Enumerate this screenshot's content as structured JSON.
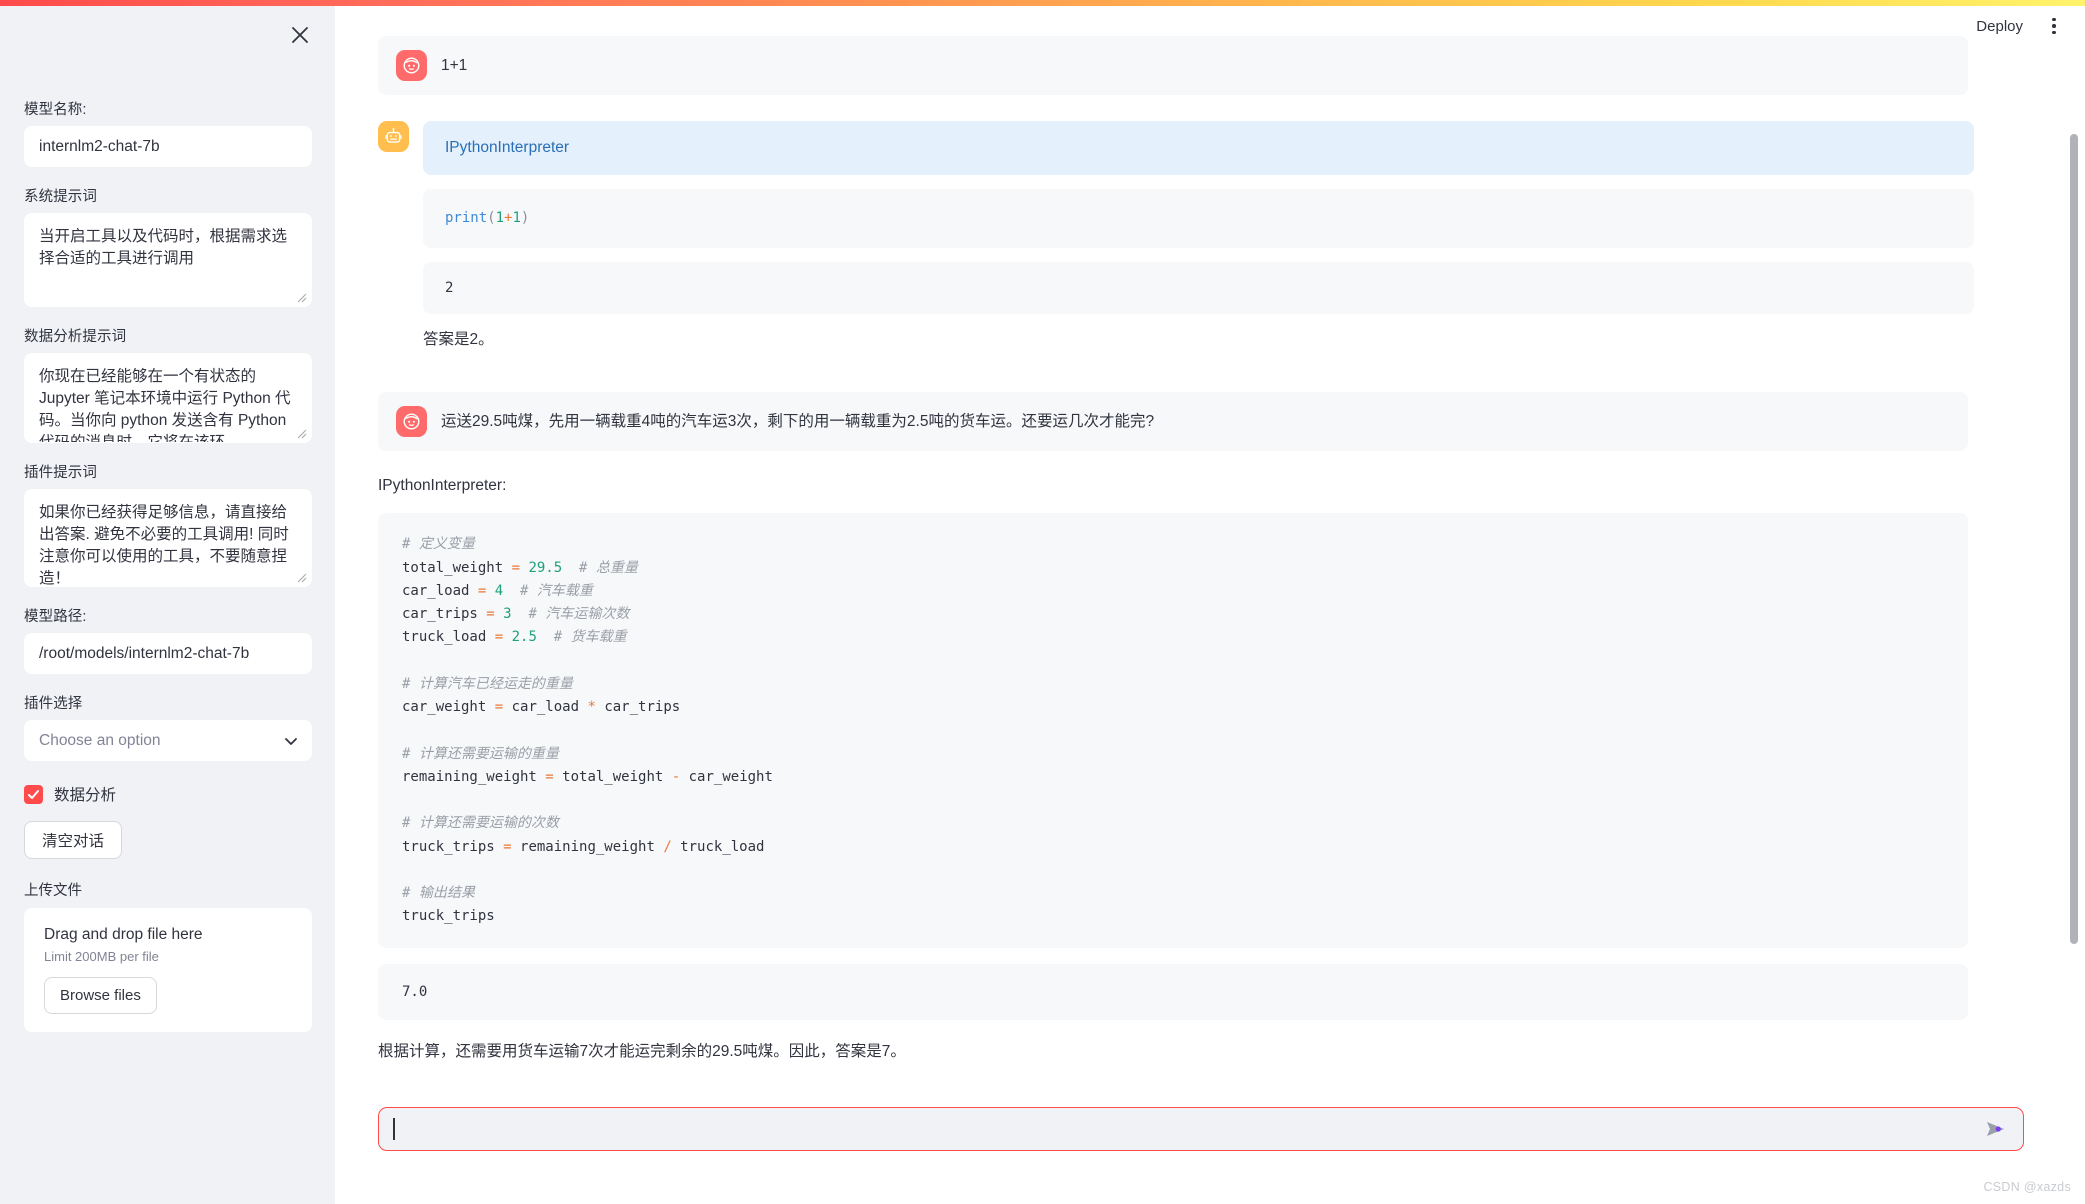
{
  "theme": {
    "accent_red": "#ff4b4b",
    "accent_yellow": "#ffd84d",
    "sidebar_bg": "#f0f2f6",
    "bubble_bg": "#f7f8fa",
    "tool_banner_bg": "#e4f0fb",
    "tool_banner_text": "#2a6fb5",
    "user_avatar": "#ff6b6b",
    "bot_avatar": "#ffbe4d",
    "send_arrow": "#7a3ff0"
  },
  "header": {
    "deploy_label": "Deploy",
    "menu_icon": "kebab-menu-icon"
  },
  "sidebar": {
    "close_icon": "close-icon",
    "model_name": {
      "label": "模型名称:",
      "value": "internlm2-chat-7b"
    },
    "system_prompt": {
      "label": "系统提示词",
      "value": "当开启工具以及代码时，根据需求选择合适的工具进行调用"
    },
    "data_analysis_prompt": {
      "label": "数据分析提示词",
      "value": "你现在已经能够在一个有状态的 Jupyter 笔记本环境中运行 Python 代码。当你向 python 发送含有 Python 代码的消息时，它将在该环"
    },
    "plugin_prompt": {
      "label": "插件提示词",
      "value": "如果你已经获得足够信息，请直接给出答案. 避免不必要的工具调用! 同时注意你可以使用的工具，不要随意捏造！"
    },
    "model_path": {
      "label": "模型路径:",
      "value": "/root/models/internlm2-chat-7b"
    },
    "plugin_select": {
      "label": "插件选择",
      "placeholder": "Choose an option",
      "chevron_icon": "chevron-down-icon"
    },
    "data_analysis_checkbox": {
      "label": "数据分析",
      "checked": true
    },
    "clear_button": "清空对话",
    "upload": {
      "label": "上传文件",
      "drop_title": "Drag and drop file here",
      "limit": "Limit 200MB per file",
      "browse_button": "Browse files"
    }
  },
  "chat": {
    "messages": [
      {
        "role": "user",
        "avatar_icon": "user-face-icon",
        "text": "1+1"
      },
      {
        "role": "assistant",
        "avatar_icon": "robot-icon",
        "tool_name": "IPythonInterpreter",
        "code_tokens": [
          {
            "t": "print",
            "c": "fn"
          },
          {
            "t": "(",
            "c": "punc"
          },
          {
            "t": "1",
            "c": "num"
          },
          {
            "t": "+",
            "c": "op"
          },
          {
            "t": "1",
            "c": "num"
          },
          {
            "t": ")",
            "c": "punc"
          }
        ],
        "output": "2",
        "answer": "答案是2。"
      },
      {
        "role": "user",
        "avatar_icon": "user-face-icon",
        "text": "运送29.5吨煤，先用一辆载重4吨的汽车运3次，剩下的用一辆载重为2.5吨的货车运。还要运几次才能完?"
      }
    ],
    "second_tool_label": "IPythonInterpreter:",
    "code_lines": [
      [
        {
          "t": "# 定义变量",
          "c": "com"
        }
      ],
      [
        {
          "t": "total_weight ",
          "c": ""
        },
        {
          "t": "=",
          "c": "op"
        },
        {
          "t": " ",
          "c": ""
        },
        {
          "t": "29.5",
          "c": "num"
        },
        {
          "t": "  ",
          "c": ""
        },
        {
          "t": "# 总重量",
          "c": "com"
        }
      ],
      [
        {
          "t": "car_load ",
          "c": ""
        },
        {
          "t": "=",
          "c": "op"
        },
        {
          "t": " ",
          "c": ""
        },
        {
          "t": "4",
          "c": "num"
        },
        {
          "t": "  ",
          "c": ""
        },
        {
          "t": "# 汽车载重",
          "c": "com"
        }
      ],
      [
        {
          "t": "car_trips ",
          "c": ""
        },
        {
          "t": "=",
          "c": "op"
        },
        {
          "t": " ",
          "c": ""
        },
        {
          "t": "3",
          "c": "num"
        },
        {
          "t": "  ",
          "c": ""
        },
        {
          "t": "# 汽车运输次数",
          "c": "com"
        }
      ],
      [
        {
          "t": "truck_load ",
          "c": ""
        },
        {
          "t": "=",
          "c": "op"
        },
        {
          "t": " ",
          "c": ""
        },
        {
          "t": "2.5",
          "c": "num"
        },
        {
          "t": "  ",
          "c": ""
        },
        {
          "t": "# 货车载重",
          "c": "com"
        }
      ],
      [],
      [
        {
          "t": "# 计算汽车已经运走的重量",
          "c": "com"
        }
      ],
      [
        {
          "t": "car_weight ",
          "c": ""
        },
        {
          "t": "=",
          "c": "op"
        },
        {
          "t": " car_load ",
          "c": ""
        },
        {
          "t": "*",
          "c": "op"
        },
        {
          "t": " car_trips",
          "c": ""
        }
      ],
      [],
      [
        {
          "t": "# 计算还需要运输的重量",
          "c": "com"
        }
      ],
      [
        {
          "t": "remaining_weight ",
          "c": ""
        },
        {
          "t": "=",
          "c": "op"
        },
        {
          "t": " total_weight ",
          "c": ""
        },
        {
          "t": "-",
          "c": "op"
        },
        {
          "t": " car_weight",
          "c": ""
        }
      ],
      [],
      [
        {
          "t": "# 计算还需要运输的次数",
          "c": "com"
        }
      ],
      [
        {
          "t": "truck_trips ",
          "c": ""
        },
        {
          "t": "=",
          "c": "op"
        },
        {
          "t": " remaining_weight ",
          "c": ""
        },
        {
          "t": "/",
          "c": "op"
        },
        {
          "t": " truck_load",
          "c": ""
        }
      ],
      [],
      [
        {
          "t": "# 输出结果",
          "c": "com"
        }
      ],
      [
        {
          "t": "truck_trips",
          "c": ""
        }
      ]
    ],
    "code_output": "7.0",
    "final_answer": "根据计算，还需要用货车运输7次才能运完剩余的29.5吨煤。因此，答案是7。"
  },
  "input_bar": {
    "value": "",
    "send_icon": "send-arrow-icon"
  },
  "watermark": "CSDN @xazds"
}
